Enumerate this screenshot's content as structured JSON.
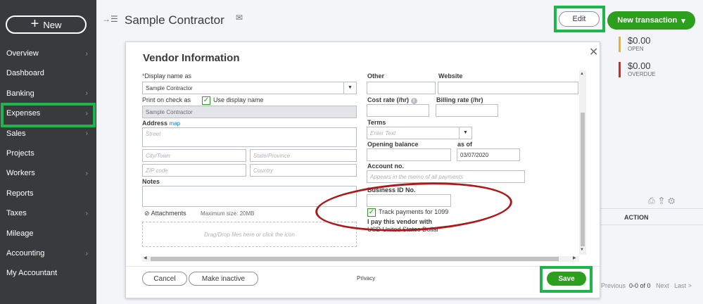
{
  "sidebar": {
    "new_label": "New",
    "items": [
      {
        "label": "Overview",
        "chevron": true
      },
      {
        "label": "Dashboard",
        "chevron": false
      },
      {
        "label": "Banking",
        "chevron": true
      },
      {
        "label": "Expenses",
        "chevron": true
      },
      {
        "label": "Sales",
        "chevron": true
      },
      {
        "label": "Projects",
        "chevron": false
      },
      {
        "label": "Workers",
        "chevron": true
      },
      {
        "label": "Reports",
        "chevron": false
      },
      {
        "label": "Taxes",
        "chevron": true
      },
      {
        "label": "Mileage",
        "chevron": false
      },
      {
        "label": "Accounting",
        "chevron": true
      },
      {
        "label": "My Accountant",
        "chevron": false
      }
    ]
  },
  "header": {
    "title": "Sample Contractor",
    "edit_label": "Edit",
    "new_transaction_label": "New transaction",
    "open_amount": "$0.00",
    "open_label": "OPEN",
    "overdue_amount": "$0.00",
    "overdue_label": "OVERDUE",
    "open_color": "#f2b01e",
    "overdue_color": "#d52b1e"
  },
  "table": {
    "action_header": "ACTION",
    "pager_prev": "Previous",
    "pager_range": "0-0 of 0",
    "pager_next": "Next",
    "pager_last": "Last >"
  },
  "modal": {
    "title": "Vendor Information",
    "display_name_label": "Display name as",
    "display_name_value": "Sample Contractor",
    "print_on_check_label": "Print on check as",
    "use_display_name_label": "Use display name",
    "print_on_check_value": "Sample Contractor",
    "address_label": "Address",
    "map_link": "map",
    "street_placeholder": "Street",
    "city_placeholder": "City/Town",
    "state_placeholder": "State/Province",
    "zip_placeholder": "ZIP code",
    "country_placeholder": "Country",
    "notes_label": "Notes",
    "attachments_label": "Attachments",
    "max_size_label": "Maximum size: 20MB",
    "dropzone_text": "Drag/Drop files here or click the icon",
    "other_label": "Other",
    "website_label": "Website",
    "cost_rate_label": "Cost rate (/hr)",
    "billing_rate_label": "Billing rate (/hr)",
    "terms_label": "Terms",
    "terms_placeholder": "Enter Text",
    "opening_balance_label": "Opening balance",
    "as_of_label": "as of",
    "as_of_value": "03/07/2020",
    "account_no_label": "Account no.",
    "account_no_placeholder": "Appears in the memo of all payments",
    "business_id_label": "Business ID No.",
    "track_1099_label": "Track payments for 1099",
    "pay_currency_label": "I pay this vendor with",
    "pay_currency_value": "USD United States Dollar",
    "cancel_label": "Cancel",
    "make_inactive_label": "Make inactive",
    "privacy_label": "Privacy",
    "save_label": "Save"
  },
  "colors": {
    "sidebar_bg": "#393a3d",
    "brand_green": "#2ca01c",
    "highlight_green": "#1db64a",
    "annotation_red": "#b0171b"
  }
}
